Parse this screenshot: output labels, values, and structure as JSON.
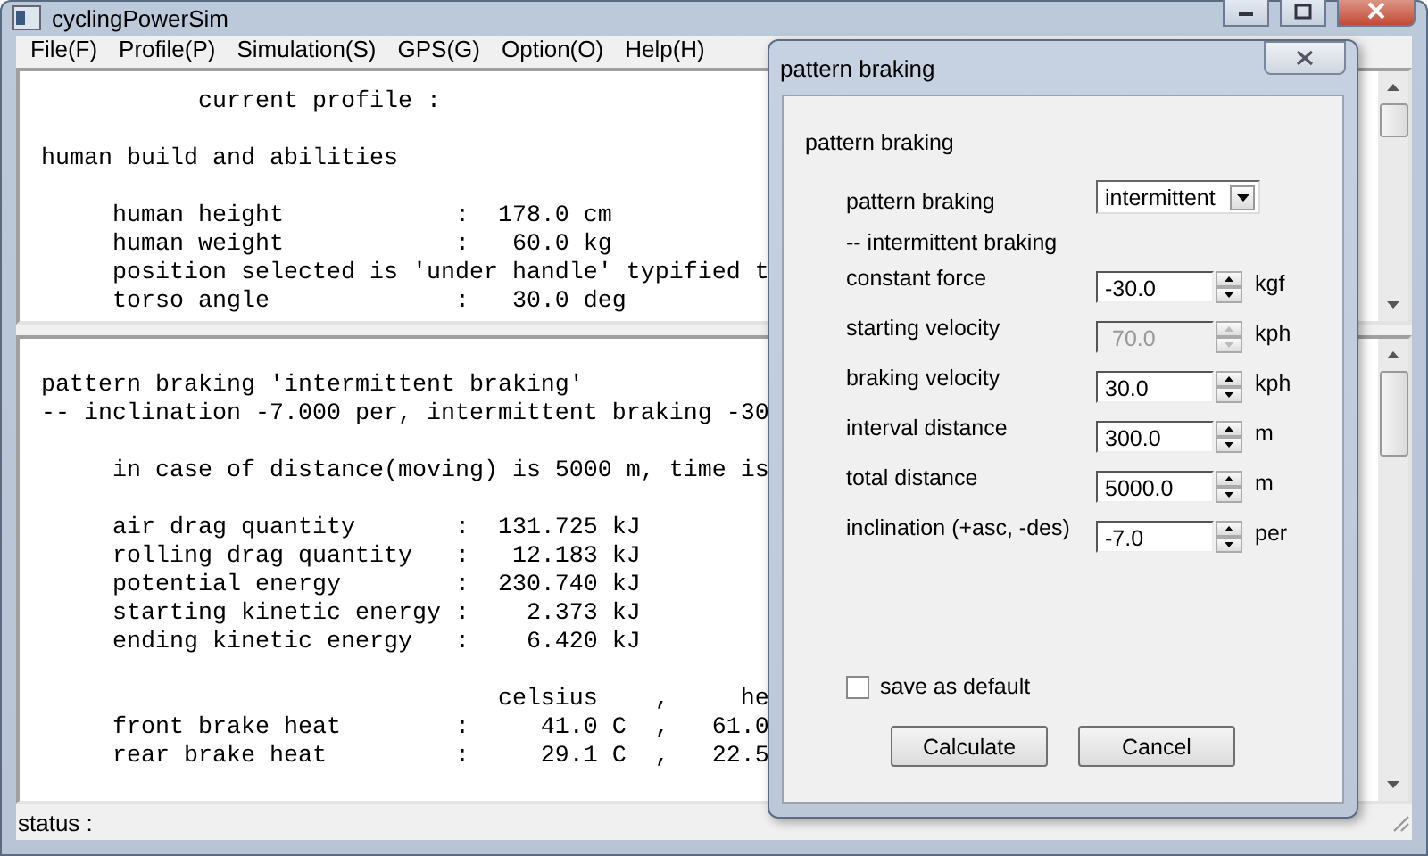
{
  "window": {
    "title": "cyclingPowerSim"
  },
  "menu": [
    "File(F)",
    "Profile(P)",
    "Simulation(S)",
    "GPS(G)",
    "Option(O)",
    "Help(H)"
  ],
  "top_pane": {
    "blocks": [
      [
        "           current profile :"
      ],
      [
        "human build and abilities"
      ],
      [
        "     human height            :  178.0 cm",
        "     human weight            :   60.0 kg",
        "     position selected is 'under handle' typified t",
        "     torso angle             :   30.0 deg"
      ]
    ]
  },
  "bottom_pane": {
    "blocks": [
      [
        "pattern braking 'intermittent braking'",
        "-- inclination -7.000 per, intermittent braking -30"
      ],
      [
        "     in case of distance(moving) is 5000 m, time is"
      ],
      [
        "     air drag quantity       :  131.725 kJ",
        "     rolling drag quantity   :   12.183 kJ",
        "     potential energy        :  230.740 kJ",
        "     starting kinetic energy :    2.373 kJ",
        "     ending kinetic energy   :    6.420 kJ"
      ],
      [
        "                                celsius    ,     he",
        "     front brake heat        :     41.0 C  ,   61.0",
        "     rear brake heat         :     29.1 C  ,   22.5"
      ]
    ]
  },
  "status_bar": "status :",
  "dialog": {
    "title": "pattern braking",
    "group_label": "pattern braking",
    "rows": [
      {
        "kind": "dropdown",
        "label": "pattern braking",
        "value": "intermittent"
      },
      {
        "kind": "note",
        "label": "-- intermittent braking"
      },
      {
        "kind": "spin",
        "label": "constant force",
        "value": "-30.0",
        "unit": "kgf",
        "disabled": false
      },
      {
        "kind": "spin",
        "label": "starting velocity",
        "value": "70.0",
        "unit": "kph",
        "disabled": true
      },
      {
        "kind": "spin",
        "label": "braking velocity",
        "value": "30.0",
        "unit": "kph",
        "disabled": false
      },
      {
        "kind": "spin",
        "label": "interval distance",
        "value": "300.0",
        "unit": "m",
        "disabled": false
      },
      {
        "kind": "spin",
        "label": "total distance",
        "value": "5000.0",
        "unit": "m",
        "disabled": false
      },
      {
        "kind": "spin",
        "label": "inclination (+asc, -des)",
        "value": "-7.0",
        "unit": "per",
        "disabled": false
      }
    ],
    "checkbox": {
      "label": "save as default",
      "checked": false
    },
    "buttons": [
      "Calculate",
      "Cancel"
    ]
  }
}
